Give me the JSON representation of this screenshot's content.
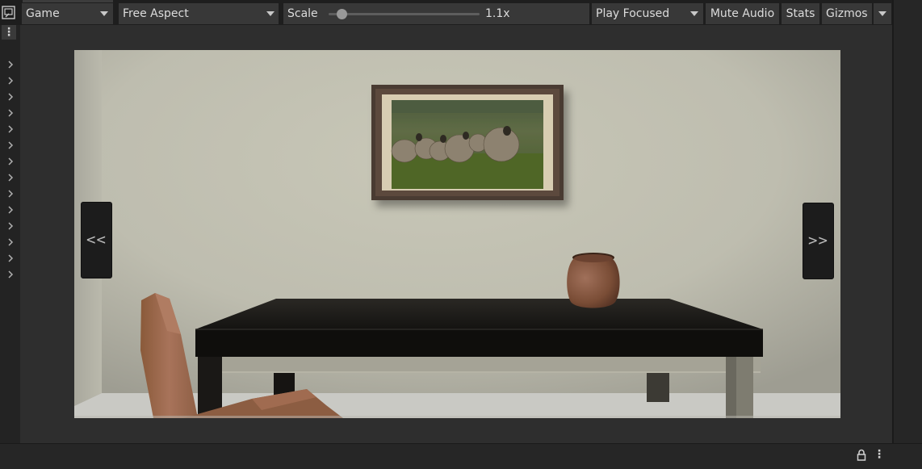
{
  "toolbar": {
    "view_name": "Game",
    "aspect": "Free Aspect",
    "scale_label": "Scale",
    "scale_value": "1.1x",
    "scale_fraction": 0.06,
    "play_mode": "Play Focused",
    "mute_audio": "Mute Audio",
    "stats": "Stats",
    "gizmos": "Gizmos"
  },
  "icons": {
    "window": "window-icon",
    "rail_menu": "kebab-menu-icon",
    "rail_items": "chevron-right-icon",
    "lock": "lock-icon",
    "bottom_menu": "kebab-menu-icon"
  },
  "left_rail": {
    "expander_count": 14
  },
  "game_view": {
    "prev_label": "<<",
    "next_label": ">>",
    "scene_objects": [
      "wall",
      "framed-sheep-painting",
      "dark-table",
      "clay-pot",
      "wooden-chair"
    ]
  },
  "colors": {
    "editor_bg": "#282828",
    "toolbar_bg": "#1e1e1e",
    "button_bg": "#383838",
    "wall": "#c2c1b2",
    "table_top": "#131210"
  }
}
